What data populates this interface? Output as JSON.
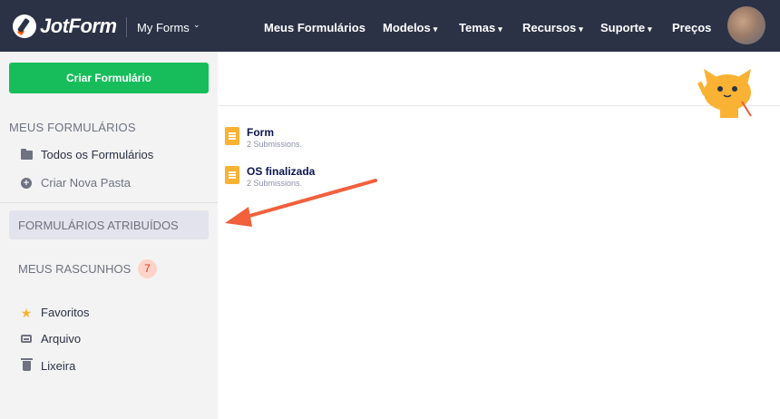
{
  "header": {
    "logo_text": "JotForm",
    "workspace_label": "My Forms",
    "nav": [
      {
        "label": "Meus Formulários",
        "caret": false
      },
      {
        "label": "Modelos",
        "caret": true
      },
      {
        "label": "Temas",
        "caret": true
      },
      {
        "label": "Recursos",
        "caret": true
      },
      {
        "label": "Suporte",
        "caret": true
      },
      {
        "label": "Preços",
        "caret": false
      }
    ],
    "caret_glyph": "▾"
  },
  "sidebar": {
    "create_button": "Criar Formulário",
    "section_title": "MEUS FORMULÁRIOS",
    "all_forms": "Todos os Formulários",
    "new_folder": "Criar Nova Pasta",
    "assigned": "FORMULÁRIOS ATRIBUÍDOS",
    "drafts": "MEUS RASCUNHOS",
    "drafts_count": "7",
    "favorites": "Favoritos",
    "archive": "Arquivo",
    "trash": "Lixeira"
  },
  "forms": [
    {
      "title": "Form",
      "subtitle": "2 Submissions."
    },
    {
      "title": "OS finalizada",
      "subtitle": "2 Submissions."
    }
  ],
  "colors": {
    "topbar": "#2b3245",
    "create_button": "#18bd5b",
    "accent_arrow": "#f2603c",
    "form_icon": "#f9b234",
    "badge_bg": "#ffd3c8"
  }
}
